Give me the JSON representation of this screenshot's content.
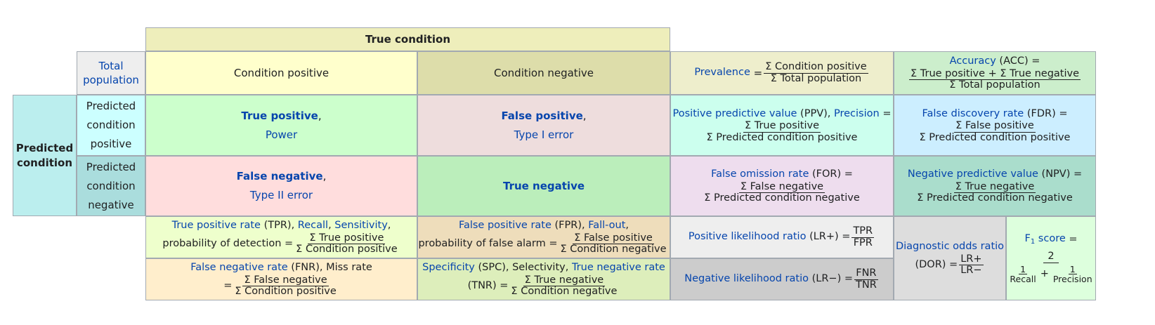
{
  "header": {
    "true_condition": "True condition",
    "total_population": "Total population",
    "condition_positive": "Condition positive",
    "condition_negative": "Condition negative",
    "predicted_condition": "Predicted condition",
    "predicted_condition_positive": "Predicted condition positive",
    "predicted_condition_negative": "Predicted condition negative"
  },
  "prevalence": {
    "label": "Prevalence",
    "eq": "=",
    "num": "Σ Condition positive",
    "den": "Σ Total population"
  },
  "accuracy": {
    "label": "Accuracy",
    "abbr": "(ACC) =",
    "num": "Σ True positive + Σ True negative",
    "den": "Σ Total population"
  },
  "tp": {
    "label": "True positive",
    "comma": ",",
    "alt": "Power"
  },
  "fp": {
    "label": "False positive",
    "comma": ",",
    "alt": "Type I error"
  },
  "fn": {
    "label": "False negative",
    "comma": ",",
    "alt": "Type II error"
  },
  "tn": {
    "label": "True negative"
  },
  "ppv": {
    "label": "Positive predictive value",
    "abbr": "(PPV),",
    "alt": "Precision",
    "eq": "=",
    "num": "Σ True positive",
    "den": "Σ Predicted condition positive"
  },
  "fdr": {
    "label": "False discovery rate",
    "abbr": "(FDR) =",
    "num": "Σ False positive",
    "den": "Σ Predicted condition positive"
  },
  "for": {
    "label": "False omission rate",
    "abbr": "(FOR) =",
    "num": "Σ False negative",
    "den": "Σ Predicted condition negative"
  },
  "npv": {
    "label": "Negative predictive value",
    "abbr": "(NPV) =",
    "num": "Σ True negative",
    "den": "Σ Predicted condition negative"
  },
  "tpr": {
    "label": "True positive rate",
    "abbr": "(TPR),",
    "alt1": "Recall",
    "comma": ",",
    "alt2": "Sensitivity",
    "comma2": ",",
    "line2": "probability of detection =",
    "num": "Σ True positive",
    "den": "Σ Condition positive"
  },
  "fpr": {
    "label": "False positive rate",
    "abbr": "(FPR),",
    "alt1": "Fall-out",
    "comma": ",",
    "line2": "probability of false alarm =",
    "num": "Σ False positive",
    "den": "Σ Condition negative"
  },
  "fnr": {
    "label": "False negative rate",
    "abbr": "(FNR), Miss rate",
    "line2": "=",
    "num": "Σ False negative",
    "den": "Σ Condition positive"
  },
  "spc": {
    "label": "Specificity",
    "abbr": "(SPC), Selectivity,",
    "alt1": "True negative rate",
    "line2": "(TNR) =",
    "num": "Σ True negative",
    "den": "Σ Condition negative"
  },
  "lrp": {
    "label": "Positive likelihood ratio",
    "abbr": "(LR+) =",
    "num": "TPR",
    "den": "FPR"
  },
  "lrn": {
    "label": "Negative likelihood ratio",
    "abbr": "(LR−) =",
    "num": "FNR",
    "den": "TNR"
  },
  "dor": {
    "label": "Diagnostic odds ratio",
    "abbr": "(DOR) =",
    "num": "LR+",
    "den": "LR−"
  },
  "f1": {
    "label": "F",
    "sub": "1",
    "label2": "score",
    "eq": "=",
    "num": "2",
    "num_a": "1",
    "den_a": "Recall",
    "plus": "+",
    "num_b": "1",
    "den_b": "Precision"
  },
  "colors": {
    "header_yellow": "#eeeebb",
    "cond_pos": "#ffffcc",
    "cond_neg": "#ddddaa",
    "total": "#eeeeee",
    "pred_cond": "#bbeeee",
    "pred_pos": "#ccffff",
    "pred_neg": "#aadddd",
    "tp": "#ccffcc",
    "fp": "#eedddd",
    "fn": "#ffdddd",
    "tn": "#bbeebb",
    "prevalence": "#eeeecc",
    "accuracy": "#cceecc",
    "ppv": "#ccffee",
    "fdr": "#cceeff",
    "for": "#eeddee",
    "npv": "#aaddcc",
    "tpr": "#eeffcc",
    "fpr": "#eeddbb",
    "fnr": "#ffeecc",
    "spc": "#ddeebb",
    "lrp": "#eeeeee",
    "lrn": "#cccccc",
    "dor": "#dddddd",
    "f1": "#ddffdd",
    "link": "#0645ad"
  }
}
